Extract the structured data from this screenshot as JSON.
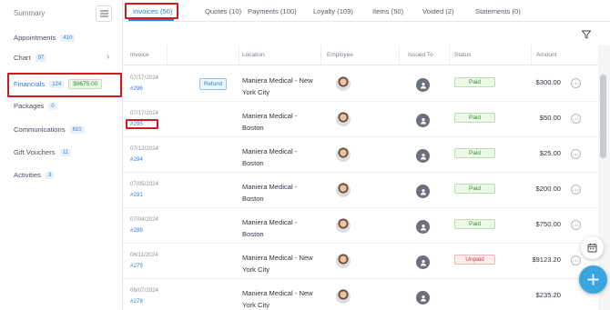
{
  "sidebar": {
    "summary_label": "Summary",
    "items": [
      {
        "label": "Appointments",
        "badge": "410"
      },
      {
        "label": "Chart",
        "badge": "97"
      },
      {
        "label": "Financials",
        "badge": "124",
        "amount": "$9675.00"
      },
      {
        "label": "Packages",
        "badge": "0"
      },
      {
        "label": "Communications",
        "badge": "610"
      },
      {
        "label": "Gift Vouchers",
        "badge": "11"
      },
      {
        "label": "Activities",
        "badge": "3"
      }
    ]
  },
  "tabs": [
    {
      "label": "Invoices (50)"
    },
    {
      "label": "Quotes (10)"
    },
    {
      "label": "Payments (100)"
    },
    {
      "label": "Loyalty (109)"
    },
    {
      "label": "Items (50)"
    },
    {
      "label": "Voided (2)"
    },
    {
      "label": "Statements (0)"
    }
  ],
  "table": {
    "headers": {
      "invoice": "Invoice",
      "location": "Location",
      "employee": "Employee",
      "issued_to": "Issued To",
      "status": "Status",
      "amount": "Amount"
    },
    "refund_label": "Refund",
    "rows": [
      {
        "date": "07/17/2024",
        "number": "#296",
        "location": "Maniera Medical - New York City",
        "status": "Paid",
        "amount": "$300.00"
      },
      {
        "date": "07/17/2024",
        "number": "#295",
        "location": "Maniera Medical - Boston",
        "status": "Paid",
        "amount": "$50.00"
      },
      {
        "date": "07/12/2024",
        "number": "#294",
        "location": "Maniera Medical - Boston",
        "status": "Paid",
        "amount": "$25.00"
      },
      {
        "date": "07/05/2024",
        "number": "#291",
        "location": "Maniera Medical - Boston",
        "status": "Paid",
        "amount": "$200.00"
      },
      {
        "date": "07/04/2024",
        "number": "#289",
        "location": "Maniera Medical - Boston",
        "status": "Paid",
        "amount": "$750.00"
      },
      {
        "date": "06/11/2024",
        "number": "#279",
        "location": "Maniera Medical - New York City",
        "status": "Unpaid",
        "amount": "$9123.20"
      },
      {
        "date": "06/07/2024",
        "number": "#278",
        "location": "Maniera Medical - New York City",
        "status": "",
        "amount": "$235.20"
      }
    ]
  },
  "colors": {
    "accent": "#2b7fd0",
    "highlight": "#d3191f",
    "fab": "#3aa6e0",
    "paid": "#2f8f2a",
    "unpaid": "#c23b3b"
  }
}
